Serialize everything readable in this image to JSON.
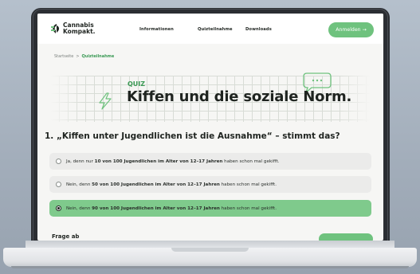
{
  "header": {
    "logo": {
      "line1": "Cannabis",
      "line2": "Kompakt."
    },
    "nav": [
      "Informationen",
      "Quizteilnahme",
      "Downloads"
    ],
    "login_label": "Anmelden",
    "login_arrow": "→"
  },
  "breadcrumb": {
    "home": "Startseite",
    "separator": ">",
    "current": "Quizteilnahme"
  },
  "hero": {
    "eyebrow": "QUIZ",
    "title": "Kiffen und die soziale Norm."
  },
  "question": {
    "text": "1. „Kiffen unter Jugendlichen ist die Ausnahme“ – stimmt das?",
    "options": [
      {
        "prefix": "Ja, denn nur ",
        "bold": "10 von 100 Jugendlichen im Alter von 12–17 Jahren",
        "suffix": " haben schon mal gekifft.",
        "selected": false
      },
      {
        "prefix": "Nein, denn ",
        "bold": "50 von 100 Jugendlichen im Alter von 12–17 Jahren",
        "suffix": " haben schon mal gekifft.",
        "selected": false
      },
      {
        "prefix": "Nein, denn ",
        "bold": "90 von 100 Jugendlichen im Alter von 12–17 Jahren",
        "suffix": " haben schon mal gekifft.",
        "selected": true
      }
    ]
  },
  "footer_partial": {
    "text": "Frage ab"
  },
  "colors": {
    "accent": "#6fc27e",
    "accent_text": "#3b9a55",
    "selected_bg": "#7fca8c",
    "option_bg": "#ebebea"
  },
  "icons": {
    "logo": "cannabis-leaf-icon",
    "bolt": "lightning-bolt-icon",
    "bubble": "speech-bubble-icon",
    "arrow": "arrow-right-icon"
  }
}
